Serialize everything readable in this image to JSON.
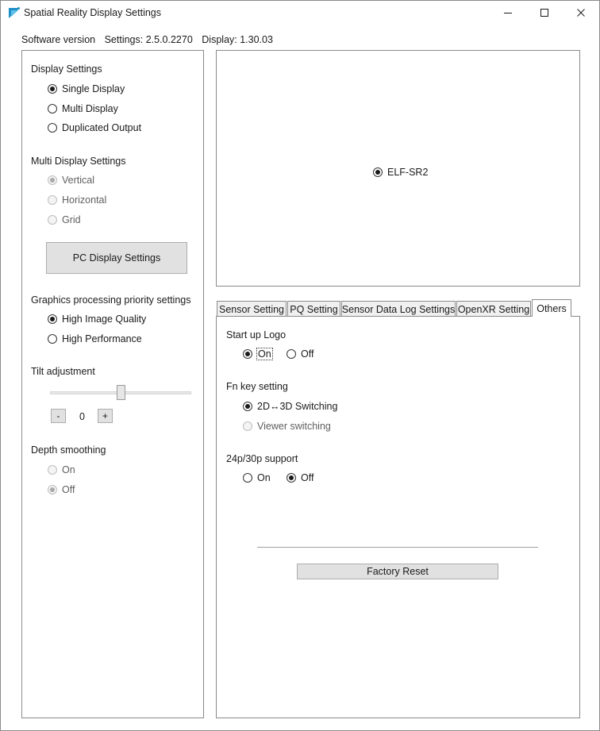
{
  "window": {
    "title": "Spatial Reality Display Settings",
    "accent_color": "#1e8fc7"
  },
  "version": {
    "label": "Software version",
    "settings": "Settings: 2.5.0.2270",
    "display": "Display: 1.30.03"
  },
  "left": {
    "display_settings": {
      "title": "Display Settings",
      "options": [
        {
          "label": "Single Display",
          "checked": true
        },
        {
          "label": "Multi Display",
          "checked": false
        },
        {
          "label": "Duplicated Output",
          "checked": false
        }
      ]
    },
    "multi_display": {
      "title": "Multi Display Settings",
      "options": [
        {
          "label": "Vertical",
          "checked": true,
          "disabled": true
        },
        {
          "label": "Horizontal",
          "checked": false,
          "disabled": true
        },
        {
          "label": "Grid",
          "checked": false,
          "disabled": true
        }
      ]
    },
    "pc_display_button": "PC Display Settings",
    "graphics_priority": {
      "title": "Graphics processing priority settings",
      "options": [
        {
          "label": "High Image Quality",
          "checked": true
        },
        {
          "label": "High Performance",
          "checked": false
        }
      ]
    },
    "tilt": {
      "title": "Tilt adjustment",
      "minus": "-",
      "plus": "+",
      "value": "0"
    },
    "depth_smoothing": {
      "title": "Depth smoothing",
      "options": [
        {
          "label": "On",
          "checked": false,
          "disabled": true
        },
        {
          "label": "Off",
          "checked": true,
          "disabled": true
        }
      ]
    }
  },
  "preview": {
    "device": {
      "label": "ELF-SR2",
      "checked": true
    }
  },
  "tabs": [
    {
      "label": "Sensor Setting",
      "active": false
    },
    {
      "label": "PQ Setting",
      "active": false
    },
    {
      "label": "Sensor Data Log Settings",
      "active": false
    },
    {
      "label": "OpenXR Setting",
      "active": false
    },
    {
      "label": "Others",
      "active": true
    }
  ],
  "others": {
    "startup_logo": {
      "title": "Start up Logo",
      "on": "On",
      "off": "Off",
      "selected": "On"
    },
    "fn_key": {
      "title": "Fn key setting",
      "options": [
        {
          "label": "2D↔3D Switching",
          "checked": true,
          "disabled": false
        },
        {
          "label": "Viewer switching",
          "checked": false,
          "disabled": true
        }
      ]
    },
    "support_24p30p": {
      "title": "24p/30p support",
      "on": "On",
      "off": "Off",
      "selected": "Off"
    },
    "factory_reset": "Factory Reset"
  }
}
